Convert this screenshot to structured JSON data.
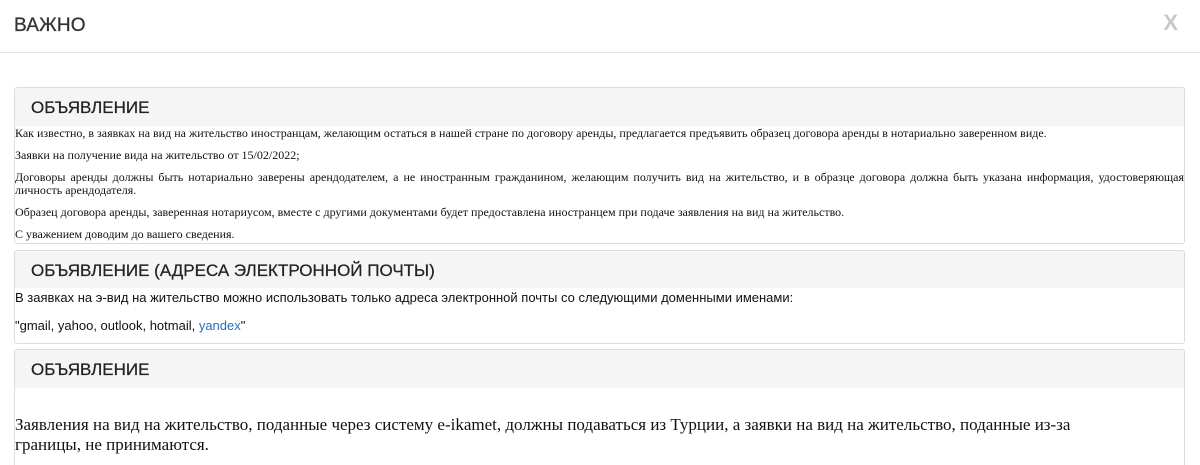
{
  "header": {
    "title": "ВАЖНО",
    "close_label": "X"
  },
  "panels": [
    {
      "heading": "ОБЪЯВЛЕНИЕ",
      "paragraphs": [
        "Как известно, в заявках на вид на жительство иностранцам, желающим остаться в нашей стране по договору аренды, предлагается предъявить образец договора аренды в нотариально заверенном виде.",
        "Заявки на получение вида на жительство от 15/02/2022;",
        "Договоры аренды должны быть нотариально заверены арендодателем, а не иностранным гражданином, желающим получить вид на жительство, и в образце договора должна быть указана информация, удостоверяющая личность арендодателя.",
        "Образец договора аренды, заверенная нотариусом, вместе с другими документами будет предоставлена иностранцем при подаче заявления на вид на жительство.",
        "С уважением доводим до вашего сведения."
      ]
    },
    {
      "heading": "ОБЪЯВЛЕНИЕ (АДРЕСА ЭЛЕКТРОННОЙ ПОЧТЫ)",
      "intro": "В заявках на э-вид на жительство можно использовать только адреса электронной почты со следующими доменными именами:",
      "domains_prefix": "\"gmail, yahoo, outlook, hotmail, ",
      "domains_link": "yandex",
      "domains_suffix": "\""
    },
    {
      "heading": "ОБЪЯВЛЕНИЕ",
      "text": "Заявления на вид на жительство, поданные через систему e-ikamet, должны подаваться из Турции, а заявки на вид на жительство, поданные из-за границы, не принимаются."
    }
  ]
}
